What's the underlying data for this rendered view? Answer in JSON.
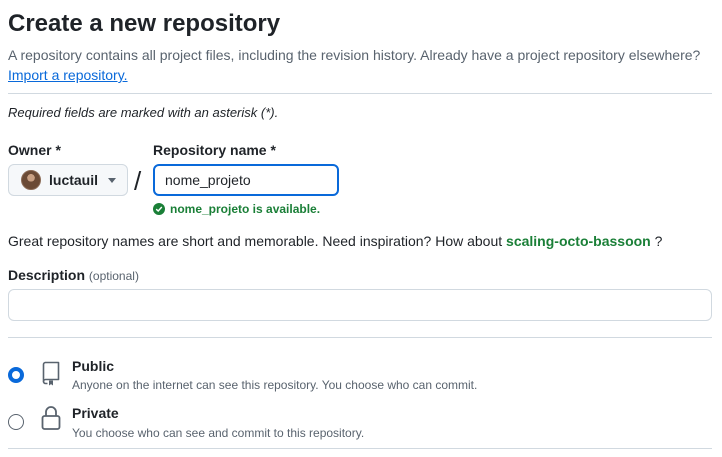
{
  "header": {
    "title": "Create a new repository",
    "subtitle": "A repository contains all project files, including the revision history. Already have a project repository elsewhere?",
    "import_link": "Import a repository."
  },
  "form": {
    "required_note": "Required fields are marked with an asterisk (*).",
    "owner": {
      "label": "Owner *",
      "selected": "luctauil",
      "icon": "caret-down-icon"
    },
    "separator": "/",
    "repo_name": {
      "label": "Repository name *",
      "value": "nome_projeto",
      "availability": "nome_projeto is available."
    },
    "suggestion": {
      "prefix": "Great repository names are short and memorable. Need inspiration? How about",
      "name": "scaling-octo-bassoon",
      "suffix": "?"
    },
    "description": {
      "label": "Description",
      "optional": "(optional)",
      "value": ""
    },
    "visibility": [
      {
        "title": "Public",
        "desc": "Anyone on the internet can see this repository. You choose who can commit.",
        "checked": true,
        "icon": "repo-icon"
      },
      {
        "title": "Private",
        "desc": "You choose who can see and commit to this repository.",
        "checked": false,
        "icon": "lock-icon"
      }
    ]
  },
  "colors": {
    "accent": "#0969da",
    "success": "#1a7f37",
    "text": "#1f2328",
    "muted": "#59636e",
    "border": "#d1d9e0"
  }
}
